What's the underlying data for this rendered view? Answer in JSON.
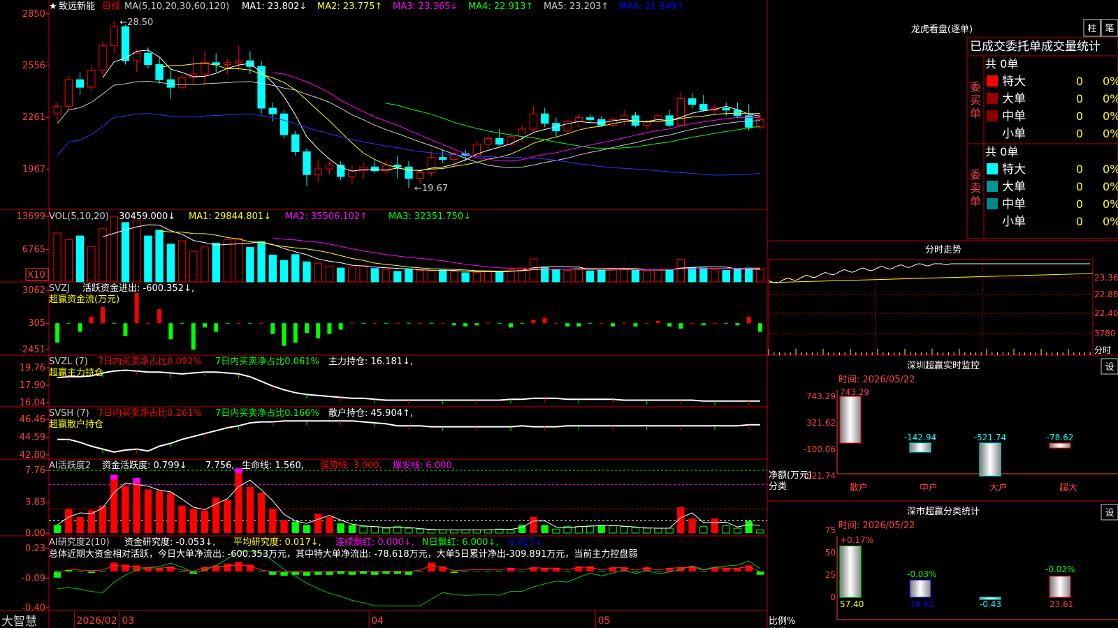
{
  "header": {
    "star": "★",
    "stock": "致远新能",
    "period": "日线",
    "ma_label": "MA(5,10,20,30,60,120)",
    "ma": [
      {
        "t": "MA1: 23.802↓",
        "c": "#ffffff"
      },
      {
        "t": "MA2: 23.775↑",
        "c": "#ffff00"
      },
      {
        "t": "MA3: 23.365↓",
        "c": "#ff00ff"
      },
      {
        "t": "MA4: 22.913↑",
        "c": "#00ff00"
      },
      {
        "t": "MA5: 23.203↑",
        "c": "#cccccc"
      },
      {
        "t": "MA6: 21.549↑",
        "c": "#0000ff"
      }
    ],
    "high": "28.50",
    "low": "19.67",
    "yticks": [
      "2850",
      "2556",
      "2261",
      "1967"
    ]
  },
  "vol": {
    "label": "VOL(5,10,20)",
    "v0": "30459.000↓",
    "ma1": "MA1: 29844.801↓",
    "ma2": "MA2: 35506.102↑",
    "ma3": "MA3: 32351.750↓",
    "yticks": [
      "13699",
      "6765"
    ],
    "unit": "X10"
  },
  "svzj": {
    "label": "SVZJ",
    "t1": "活跃资金进出: -600.352↓,",
    "sub": "超赢资金流(万元)",
    "yticks": [
      "3062",
      "305",
      "-2451"
    ]
  },
  "svzl": {
    "label": "SVZL (7)",
    "t1": "7日内买卖净占比0.092%",
    "t2": "7日内买卖净占比0.061%",
    "t3": "主力持仓: 16.181↓,",
    "sub": "超赢主力持仓",
    "yticks": [
      "19.76",
      "17.90",
      "16.04"
    ]
  },
  "svsh": {
    "label": "SVSH (7)",
    "t1": "7日内买卖净占比0.261%",
    "t2": "7日内买卖净占比0.166%",
    "t3": "散户持仓: 45.904↑,",
    "sub": "超赢散户持仓",
    "yticks": [
      "46.46",
      "44.59",
      "42.80"
    ]
  },
  "ai1": {
    "label": "AI活跃度2",
    "t1": "资金活跃度: 0.799↓",
    "t2": "7.756,",
    "t3": "生命线: 1.560,",
    "t4": "强势线: 3.000,",
    "t5": "爆发线: 6.000,",
    "yticks": [
      "7.76",
      "3.83",
      "0.00"
    ]
  },
  "ai2": {
    "label": "AI研究度2(10)",
    "t1": "资金研究度: -0.053↓,",
    "t2": "平均研究度: 0.017↓,",
    "t3": "连续飘红: 0.000↓,",
    "t4": "N日飘红: 6.000↓,",
    "t5": "0.017↓",
    "note": "总体近期大资金相对活跃，今日大单净流出: -600.353万元，其中特大单净流出: -78.618万元，大单5日累计净出-309.891万元，当前主力控盘弱",
    "yticks": [
      "0.23",
      "-0.09",
      "-0.40"
    ]
  },
  "xaxis": {
    "brand": "大智慧",
    "dates": [
      "2026/02",
      "03",
      "04",
      "05"
    ]
  },
  "lhb": {
    "title": "龙虎看盘(逐单)",
    "btn1": "柱",
    "btn2": "笔",
    "tab": "已成交委托单成交量统计",
    "buy_total": "共 0单",
    "sell_total": "共 0单",
    "buy_side": "委买单",
    "sell_side": "委卖单",
    "rows": [
      {
        "name": "特大",
        "val": "0",
        "pct": "0%"
      },
      {
        "name": "大单",
        "val": "0",
        "pct": "0%"
      },
      {
        "name": "中单",
        "val": "0",
        "pct": "0%"
      },
      {
        "name": "小单",
        "val": "0",
        "pct": "0%"
      }
    ],
    "buy_colors": [
      "#ff0000",
      "#990000",
      "#880000"
    ],
    "sell_colors": [
      "#00ffff",
      "#009999",
      "#008888"
    ]
  },
  "fenshi": {
    "title": "分时走势",
    "yticks": [
      "23.36",
      "22.88",
      "22.40",
      "3780"
    ],
    "unit": "分时"
  },
  "monitor": {
    "title": "深圳超赢实时监控",
    "btn": "设",
    "date": "时间: 2026/05/22",
    "yticks": [
      "743.29",
      "321.62",
      "-100.06",
      "-521.74"
    ],
    "ylabel1": "净额(万元)",
    "ylabel2": "分类",
    "values": [
      "743.29",
      "-142.94",
      "-521.74",
      "-78.62"
    ],
    "cats": [
      "散户",
      "中户",
      "大户",
      "超大"
    ]
  },
  "classify": {
    "title": "深市超赢分类统计",
    "btn": "设",
    "date": "时间: 2026/05/22",
    "yticks": [
      "75",
      "50",
      "25",
      "0"
    ],
    "ylabel1": "比例%",
    "ylabel2": "分类",
    "pcts": [
      "+0.17%",
      "-0.03%",
      "-0.02%"
    ],
    "values": [
      "57.40",
      "19.42",
      "-0.43",
      "23.61"
    ],
    "cats": [
      "散户",
      "中户",
      "大户",
      "超大"
    ]
  },
  "chart_data": [
    {
      "type": "candlestick",
      "title": "致远新能 日线",
      "ylim": [
        19.67,
        28.5
      ],
      "ohlc": [
        [
          23.6,
          24.2,
          23.2,
          24.0
        ],
        [
          24.0,
          25.6,
          23.8,
          25.4
        ],
        [
          25.4,
          25.8,
          24.6,
          25.0
        ],
        [
          25.0,
          26.2,
          24.8,
          25.9
        ],
        [
          25.9,
          27.4,
          25.6,
          27.2
        ],
        [
          27.2,
          28.5,
          26.8,
          28.2
        ],
        [
          28.2,
          28.3,
          26.2,
          26.4
        ],
        [
          26.4,
          27.0,
          25.8,
          26.8
        ],
        [
          26.8,
          27.1,
          26.0,
          26.2
        ],
        [
          26.2,
          26.6,
          25.2,
          25.4
        ],
        [
          25.4,
          25.9,
          24.4,
          25.0
        ],
        [
          25.0,
          25.7,
          24.8,
          25.5
        ],
        [
          25.5,
          26.6,
          25.2,
          25.7
        ],
        [
          25.7,
          26.9,
          25.1,
          26.3
        ],
        [
          26.3,
          26.8,
          25.8,
          26.2
        ],
        [
          26.2,
          26.5,
          25.7,
          26.3
        ],
        [
          26.3,
          27.2,
          25.9,
          26.4
        ],
        [
          26.4,
          26.9,
          25.7,
          26.1
        ],
        [
          26.1,
          26.4,
          23.6,
          23.9
        ],
        [
          23.9,
          24.2,
          23.2,
          23.6
        ],
        [
          23.6,
          23.8,
          22.3,
          22.5
        ],
        [
          22.5,
          22.7,
          21.4,
          21.6
        ],
        [
          21.6,
          21.8,
          19.8,
          20.4
        ],
        [
          20.4,
          21.2,
          20.0,
          20.7
        ],
        [
          20.7,
          21.1,
          20.4,
          20.9
        ],
        [
          20.9,
          21.1,
          20.1,
          20.3
        ],
        [
          20.3,
          20.9,
          19.9,
          20.6
        ],
        [
          20.6,
          21.0,
          20.2,
          20.8
        ],
        [
          20.8,
          21.2,
          20.5,
          20.6
        ],
        [
          20.6,
          21.2,
          20.3,
          20.9
        ],
        [
          20.9,
          21.4,
          20.2,
          20.8
        ],
        [
          20.8,
          21.1,
          19.7,
          20.2
        ],
        [
          20.2,
          20.6,
          19.9,
          20.5
        ],
        [
          20.5,
          21.6,
          20.3,
          21.3
        ],
        [
          21.3,
          21.7,
          21.0,
          21.2
        ],
        [
          21.2,
          21.6,
          21.0,
          21.5
        ],
        [
          21.5,
          21.7,
          21.1,
          21.4
        ],
        [
          21.4,
          22.2,
          21.3,
          22.0
        ],
        [
          22.0,
          22.6,
          21.8,
          22.3
        ],
        [
          22.3,
          22.8,
          21.9,
          22.0
        ],
        [
          22.0,
          22.6,
          21.9,
          22.4
        ],
        [
          22.4,
          23.0,
          22.1,
          22.8
        ],
        [
          22.8,
          24.0,
          22.6,
          23.6
        ],
        [
          23.6,
          23.9,
          22.9,
          23.1
        ],
        [
          23.1,
          23.4,
          22.4,
          22.7
        ],
        [
          22.7,
          23.3,
          22.6,
          23.2
        ],
        [
          23.2,
          23.6,
          22.9,
          23.4
        ],
        [
          23.4,
          23.6,
          23.1,
          23.3
        ],
        [
          23.3,
          23.5,
          22.9,
          23.0
        ],
        [
          23.0,
          23.4,
          22.9,
          23.3
        ],
        [
          23.3,
          23.8,
          23.0,
          23.5
        ],
        [
          23.5,
          23.7,
          22.9,
          23.0
        ],
        [
          23.0,
          23.3,
          22.8,
          23.2
        ],
        [
          23.2,
          23.6,
          23.1,
          23.5
        ],
        [
          23.5,
          23.8,
          22.9,
          23.0
        ],
        [
          23.0,
          24.8,
          23.0,
          24.4
        ],
        [
          24.4,
          24.7,
          23.9,
          24.1
        ],
        [
          24.1,
          24.6,
          23.7,
          23.8
        ],
        [
          23.8,
          24.1,
          23.6,
          23.9
        ],
        [
          23.9,
          24.2,
          23.5,
          23.8
        ],
        [
          23.8,
          24.2,
          23.4,
          23.5
        ],
        [
          23.5,
          24.1,
          22.7,
          22.9
        ],
        [
          22.9,
          23.6,
          22.8,
          23.3
        ]
      ]
    },
    {
      "type": "bar",
      "title": "VOL(5,10,20)",
      "ylim": [
        0,
        13699
      ],
      "values": [
        10200,
        8800,
        9600,
        7400,
        11200,
        13699,
        12400,
        12800,
        9600,
        10800,
        7900,
        8600,
        6400,
        7300,
        8100,
        8800,
        9100,
        7200,
        8400,
        5600,
        4500,
        5700,
        4200,
        3900,
        3300,
        2900,
        3100,
        3400,
        2800,
        2600,
        2200,
        2700,
        2400,
        2300,
        2500,
        2100,
        1900,
        2000,
        2300,
        2200,
        2600,
        2900,
        4800,
        3100,
        2500,
        2400,
        2700,
        2300,
        2500,
        2600,
        2700,
        2400,
        2300,
        2500,
        2600,
        4700,
        3000,
        2900,
        2500,
        2400,
        2700,
        2900,
        2600
      ]
    },
    {
      "type": "bar",
      "title": "超赢资金流(万元)",
      "ylim": [
        -2451,
        3062
      ],
      "values": [
        -1800,
        0,
        -800,
        600,
        1500,
        0,
        -1200,
        2800,
        0,
        1300,
        -1500,
        0,
        -2451,
        -400,
        -800,
        0,
        0,
        0,
        0,
        -1000,
        -2100,
        -1800,
        -900,
        -1400,
        -1000,
        -600,
        0,
        0,
        0,
        0,
        0,
        0,
        0,
        0,
        0,
        -200,
        -300,
        -200,
        0,
        0,
        -400,
        0,
        300,
        500,
        0,
        -300,
        -300,
        0,
        0,
        -300,
        0,
        -300,
        0,
        200,
        -300,
        -500,
        0,
        -200,
        0,
        0,
        -200,
        600,
        -800
      ]
    },
    {
      "type": "line",
      "title": "超赢主力持仓",
      "ylim": [
        16.04,
        19.76
      ],
      "values": [
        18.7,
        18.8,
        18.8,
        18.9,
        19.2,
        19.4,
        19.5,
        19.4,
        19.3,
        19.3,
        19.2,
        19.1,
        19.2,
        19.3,
        19.3,
        19.2,
        19.1,
        18.8,
        18.3,
        17.8,
        17.4,
        17.1,
        16.9,
        16.8,
        16.7,
        16.6,
        16.5,
        16.5,
        16.4,
        16.3,
        16.3,
        16.3,
        16.3,
        16.3,
        16.3,
        16.3,
        16.3,
        16.3,
        16.3,
        16.3,
        16.4,
        16.4,
        16.5,
        16.5,
        16.5,
        16.4,
        16.4,
        16.4,
        16.4,
        16.4,
        16.3,
        16.3,
        16.3,
        16.3,
        16.3,
        16.3,
        16.3,
        16.2,
        16.2,
        16.2,
        16.2,
        16.2,
        16.2
      ]
    },
    {
      "type": "line",
      "title": "超赢散户持仓",
      "ylim": [
        42.8,
        46.46
      ],
      "values": [
        44.4,
        44.4,
        44.1,
        43.7,
        43.4,
        43.1,
        43.3,
        43.4,
        43.2,
        43.7,
        44.0,
        44.4,
        44.7,
        45.0,
        45.3,
        45.6,
        45.8,
        46.1,
        46.2,
        46.2,
        46.3,
        46.3,
        46.3,
        46.3,
        46.3,
        46.3,
        46.3,
        46.2,
        46.1,
        46.0,
        45.8,
        45.8,
        45.8,
        45.7,
        45.7,
        45.7,
        45.7,
        45.7,
        45.7,
        45.7,
        45.7,
        45.8,
        45.7,
        45.7,
        45.7,
        45.8,
        45.8,
        45.8,
        45.8,
        45.8,
        45.8,
        45.8,
        45.8,
        45.8,
        45.8,
        45.8,
        45.8,
        45.8,
        45.8,
        45.8,
        45.8,
        45.9,
        45.9
      ]
    },
    {
      "type": "bar",
      "title": "AI活跃度2",
      "ylim": [
        0,
        7.76
      ],
      "values": [
        1.0,
        3.0,
        2.0,
        2.8,
        3.4,
        6.6,
        5.8,
        6.2,
        5.4,
        5.2,
        5.0,
        3.4,
        3.0,
        2.8,
        4.4,
        4.1,
        7.4,
        5.7,
        5.0,
        3.0,
        1.6,
        1.4,
        1.0,
        2.4,
        2.0,
        1.2,
        1.0,
        0.8,
        0.8,
        0.6,
        0.8,
        0.6,
        0.5,
        0.4,
        0.4,
        0.4,
        0.4,
        0.4,
        0.4,
        0.5,
        0.4,
        1.0,
        2.0,
        1.0,
        0.5,
        0.8,
        0.8,
        0.9,
        1.0,
        0.9,
        0.8,
        0.7,
        0.6,
        0.6,
        0.6,
        3.2,
        1.8,
        0.8,
        1.8,
        0.9,
        0.6,
        1.5,
        0.4
      ]
    },
    {
      "type": "bar",
      "title": "AI研究度2(10)",
      "ylim": [
        -0.4,
        0.23
      ],
      "values": [
        -0.08,
        0.0,
        -0.02,
        -0.03,
        -0.02,
        0.08,
        0.06,
        0.05,
        0.03,
        0.02,
        0.04,
        -0.02,
        -0.04,
        0.03,
        0.05,
        0.07,
        0.09,
        0.06,
        -0.02,
        -0.05,
        -0.06,
        -0.05,
        -0.06,
        -0.05,
        -0.05,
        -0.04,
        -0.05,
        -0.04,
        -0.05,
        -0.04,
        -0.04,
        -0.05,
        -0.02,
        0.08,
        0.04,
        -0.03,
        -0.02,
        -0.01,
        -0.01,
        -0.02,
        0.02,
        -0.01,
        0.03,
        0.02,
        0.02,
        -0.01,
        0.04,
        0.04,
        -0.02,
        0.03,
        0.03,
        -0.02,
        0.03,
        -0.02,
        0.02,
        0.03,
        0.04,
        -0.02,
        0.03,
        0.02,
        0.02,
        0.05,
        -0.05
      ]
    }
  ]
}
